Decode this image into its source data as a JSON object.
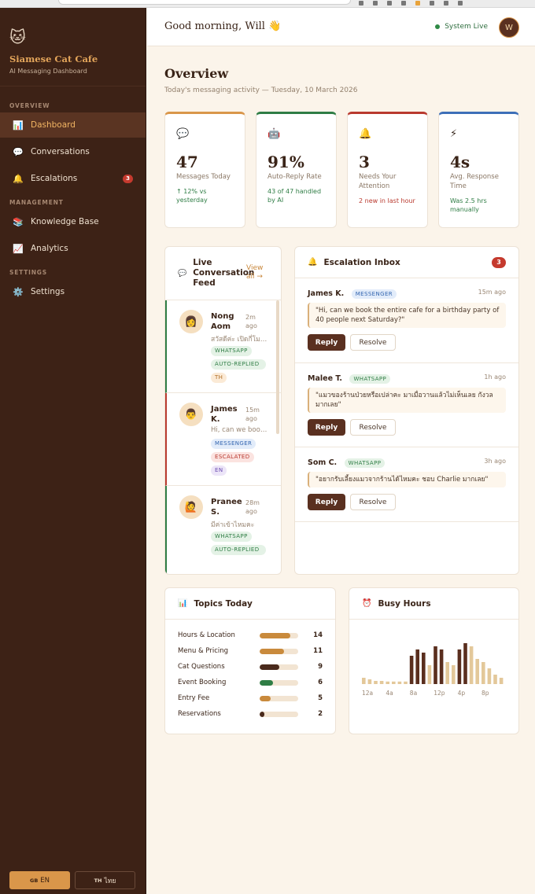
{
  "brand": {
    "logo": "🐱",
    "name": "Siamese Cat Cafe",
    "subtitle": "AI Messaging Dashboard"
  },
  "sidebar": {
    "sections": [
      {
        "label": "OVERVIEW",
        "items": [
          {
            "label": "Dashboard",
            "icon": "📊",
            "active": true
          },
          {
            "label": "Conversations",
            "icon": "💬"
          },
          {
            "label": "Escalations",
            "icon": "🔔",
            "badge": "3"
          }
        ]
      },
      {
        "label": "MANAGEMENT",
        "items": [
          {
            "label": "Knowledge Base",
            "icon": "📚"
          },
          {
            "label": "Analytics",
            "icon": "📈"
          }
        ]
      },
      {
        "label": "SETTINGS",
        "items": [
          {
            "label": "Settings",
            "icon": "⚙️"
          }
        ]
      }
    ],
    "languages": [
      {
        "flag": "GB",
        "label": "EN",
        "active": true
      },
      {
        "flag": "TH",
        "label": "ไทย",
        "active": false
      }
    ]
  },
  "topbar": {
    "greeting": "Good morning, Will 👋",
    "status": "System Live",
    "avatar": "W"
  },
  "page": {
    "title": "Overview",
    "subtitle": "Today's messaging activity — Tuesday, 10 March 2026"
  },
  "stats": [
    {
      "icon": "💬",
      "value": "47",
      "label": "Messages Today",
      "note": "↑ 12% vs yesterday",
      "accent": "#d9964a",
      "note_color": "#2f7d45"
    },
    {
      "icon": "🤖",
      "value": "91%",
      "label": "Auto-Reply Rate",
      "note": "43 of 47 handled by AI",
      "accent": "#2f7d45",
      "note_color": "#2f7d45"
    },
    {
      "icon": "🔔",
      "value": "3",
      "label": "Needs Your Attention",
      "note": "2 new in last hour",
      "accent": "#b93a2f",
      "note_color": "#b93a2f"
    },
    {
      "icon": "⚡",
      "value": "4s",
      "label": "Avg. Response Time",
      "note": "Was 2.5 hrs manually",
      "accent": "#3d6fb8",
      "note_color": "#2f7d45"
    }
  ],
  "live_feed": {
    "title": "Live Conversation Feed",
    "icon": "💬",
    "view_all": "View all →",
    "items": [
      {
        "avatar": "👩",
        "name": "Nong Aom",
        "time": "2m ago",
        "preview": "สวัสดีค่ะ เปิดกี่โมงคะ",
        "tags": [
          {
            "text": "WHATSAPP",
            "kind": "whatsapp"
          },
          {
            "text": "AUTO-REPLIED",
            "kind": "auto"
          },
          {
            "text": "TH",
            "kind": "th"
          }
        ],
        "escalated": false
      },
      {
        "avatar": "👨",
        "name": "James K.",
        "time": "15m ago",
        "preview": "Hi, can we book the entire cafe",
        "tags": [
          {
            "text": "MESSENGER",
            "kind": "messenger"
          },
          {
            "text": "ESCALATED",
            "kind": "escalated"
          },
          {
            "text": "EN",
            "kind": "en"
          }
        ],
        "escalated": true
      },
      {
        "avatar": "🙋",
        "name": "Pranee S.",
        "time": "28m ago",
        "preview": "มีค่าเข้าไหมคะ",
        "tags": [
          {
            "text": "WHATSAPP",
            "kind": "whatsapp"
          },
          {
            "text": "AUTO-REPLIED",
            "kind": "auto"
          }
        ],
        "escalated": false
      }
    ]
  },
  "escalation_inbox": {
    "title": "Escalation Inbox",
    "icon": "🔔",
    "count": "3",
    "reply_label": "Reply",
    "resolve_label": "Resolve",
    "items": [
      {
        "name": "James K.",
        "channel": "MESSENGER",
        "channel_kind": "messenger",
        "time": "15m ago",
        "message": "\"Hi, can we book the entire cafe for a birthday party of 40 people next Saturday?\""
      },
      {
        "name": "Malee T.",
        "channel": "WHATSAPP",
        "channel_kind": "whatsapp",
        "time": "1h ago",
        "message": "\"แมวของร้านป่วยหรือเปล่าคะ มาเมื่อวานแล้วไม่เห็นเลย กังวลมากเลย\""
      },
      {
        "name": "Som C.",
        "channel": "WHATSAPP",
        "channel_kind": "whatsapp",
        "time": "3h ago",
        "message": "\"อยากรับเลี้ยงแมวจากร้านได้ไหมคะ ชอบ Charlie มากเลย\""
      }
    ]
  },
  "topics": {
    "title": "Topics Today",
    "icon": "📊",
    "max": 14,
    "items": [
      {
        "name": "Hours & Location",
        "count": 14,
        "color": "#c98a3c"
      },
      {
        "name": "Menu & Pricing",
        "count": 11,
        "color": "#c98a3c"
      },
      {
        "name": "Cat Questions",
        "count": 9,
        "color": "#4a2a1c"
      },
      {
        "name": "Event Booking",
        "count": 6,
        "color": "#2f7d45"
      },
      {
        "name": "Entry Fee",
        "count": 5,
        "color": "#c98a3c"
      },
      {
        "name": "Reservations",
        "count": 2,
        "color": "#4a2a1c"
      }
    ]
  },
  "busy_hours": {
    "title": "Busy Hours",
    "icon": "⏰",
    "chart_data": {
      "type": "bar",
      "categories": [
        "0",
        "1",
        "2",
        "3",
        "4",
        "5",
        "6",
        "7",
        "8",
        "9",
        "10",
        "11",
        "12",
        "13",
        "14",
        "15",
        "16",
        "17",
        "18",
        "19",
        "20",
        "21",
        "22",
        "23"
      ],
      "values": [
        2,
        1.5,
        1,
        1,
        0.8,
        0.8,
        0.8,
        0.8,
        9,
        11,
        10,
        6,
        12,
        11,
        7,
        6,
        11,
        13,
        12,
        8,
        7,
        5,
        3,
        2
      ],
      "peak_hours": [
        8,
        9,
        10,
        12,
        13,
        16,
        17
      ],
      "tick_labels": [
        "12a",
        "4a",
        "8a",
        "12p",
        "4p",
        "8p"
      ],
      "tick_positions": [
        0,
        4,
        8,
        12,
        16,
        20
      ],
      "ylim": [
        0,
        13
      ],
      "colors": {
        "normal": "#e3c89a",
        "peak": "#5a2e1e"
      }
    }
  }
}
